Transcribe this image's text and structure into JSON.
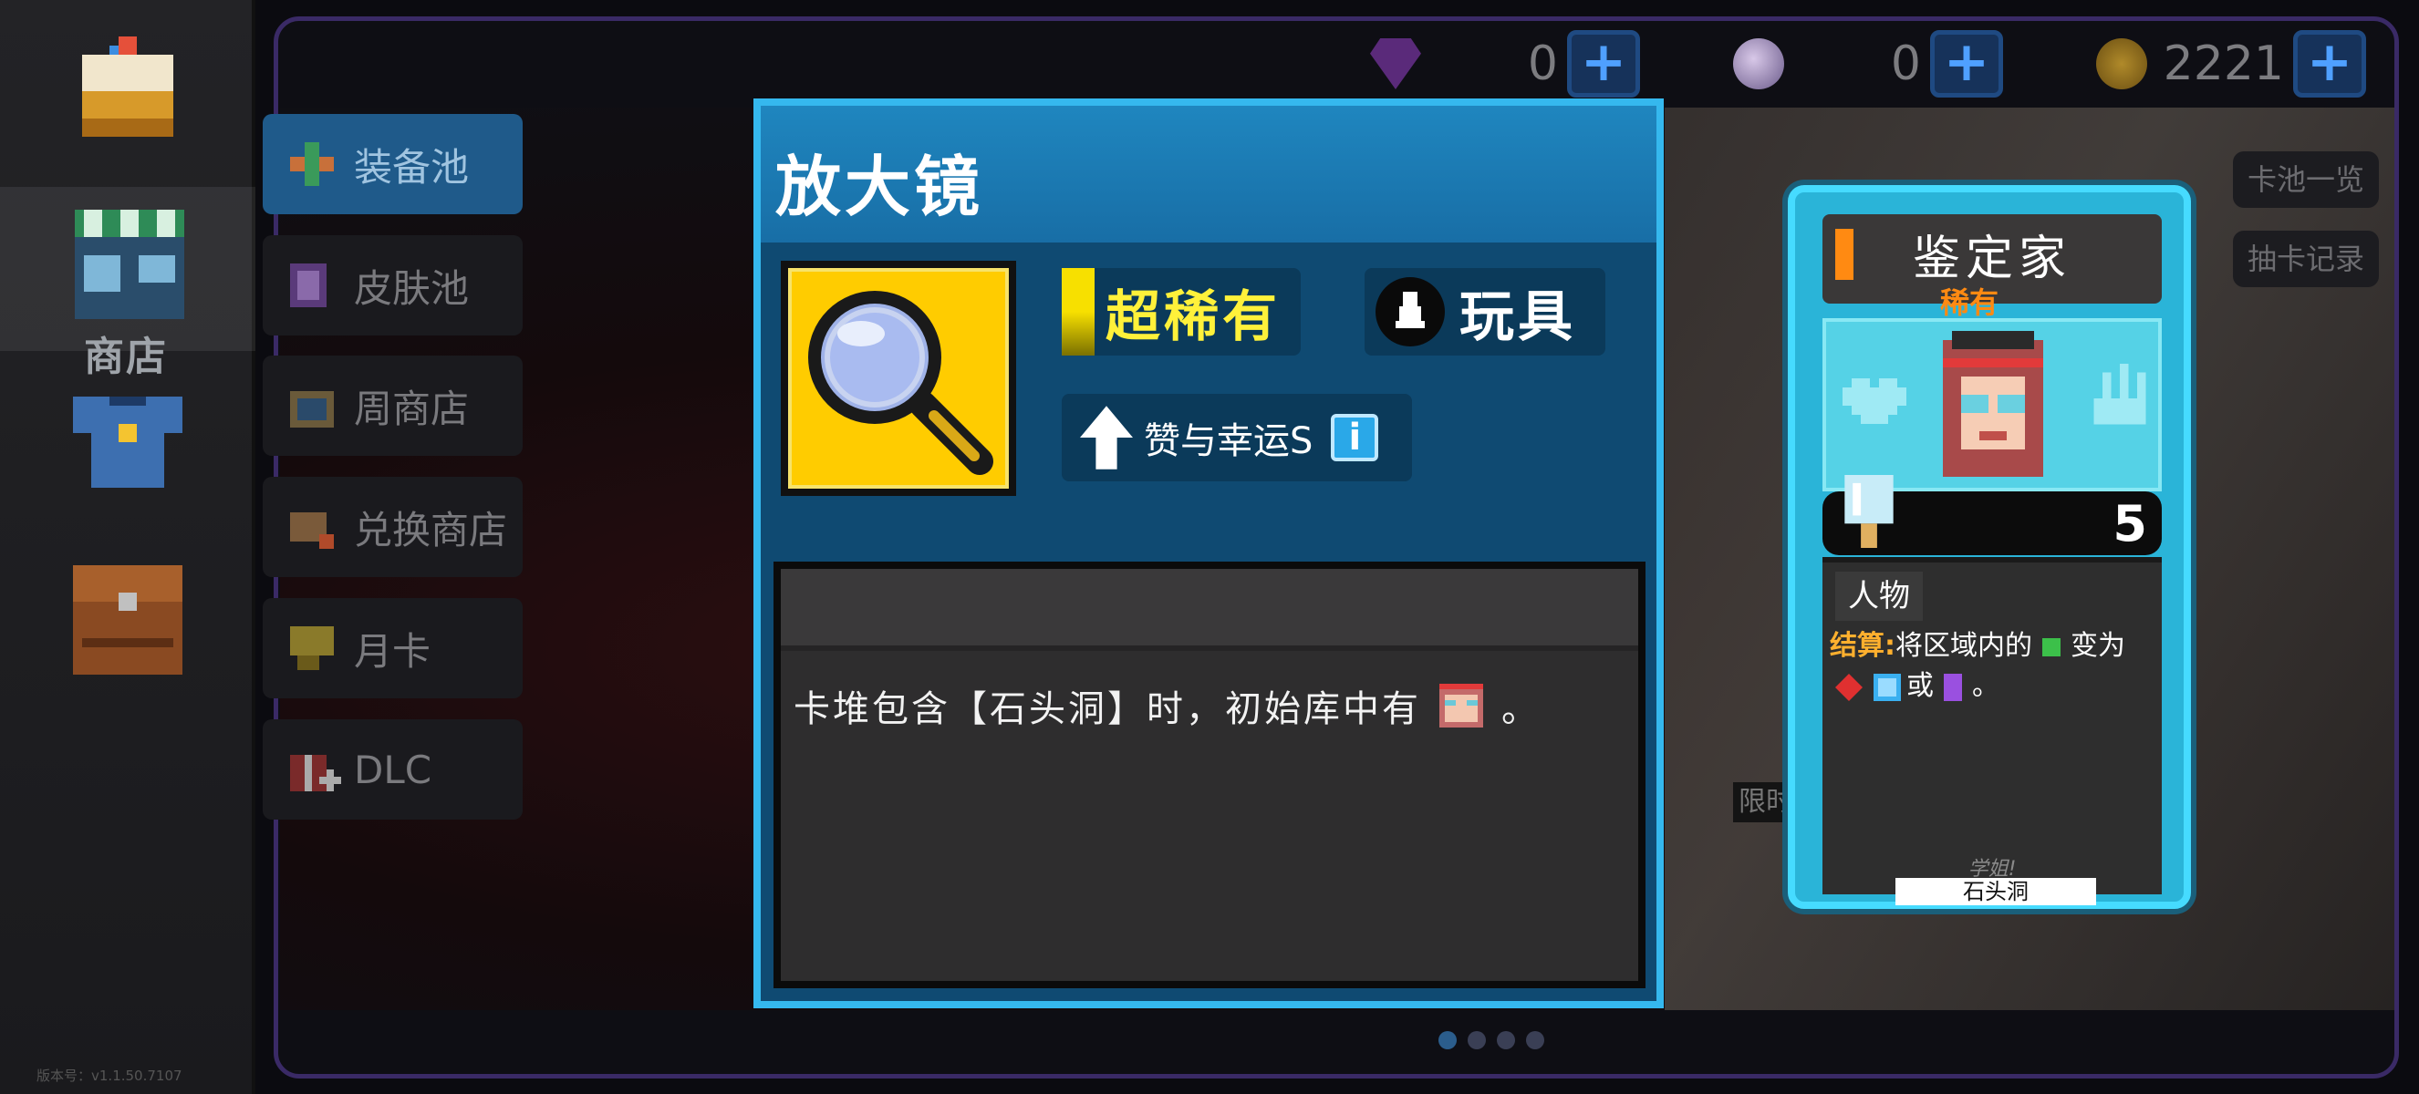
{
  "rail": {
    "shop_label": "商店",
    "version": "版本号：v1.1.50.7107"
  },
  "currencies": [
    {
      "name": "gem",
      "value": "0",
      "plus": "+"
    },
    {
      "name": "orb",
      "value": "0",
      "plus": "+"
    },
    {
      "name": "coin",
      "value": "2221",
      "plus": "+"
    }
  ],
  "tabs": [
    {
      "label": "装备池"
    },
    {
      "label": "皮肤池"
    },
    {
      "label": "周商店"
    },
    {
      "label": "兑换商店"
    },
    {
      "label": "月卡"
    },
    {
      "label": "DLC"
    }
  ],
  "side_buttons": {
    "pool_list": "卡池一览",
    "draw_history": "抽卡记录"
  },
  "dialog": {
    "title": "放大镜",
    "rarity": "超稀有",
    "type": "玩具",
    "tag": "赞与幸运S",
    "info": "i",
    "description_before": "卡堆包含【石头洞】时，初始库中有",
    "description_after": "。"
  },
  "card": {
    "name": "鉴定家",
    "rarity": "稀有",
    "count": "5",
    "type": "人物",
    "effect_key": "结算:",
    "effect_part1": "将区域内的",
    "effect_part2": "变为",
    "effect_part3": "或",
    "effect_part4": "。",
    "flavor": "学姐!",
    "area": "石头洞"
  },
  "limited_tag": "限时",
  "pager": {
    "pages": 4,
    "current": 1
  },
  "colors": {
    "dialog_border": "#35b8ee",
    "rarity_super": "#fff13a",
    "rarity_rare": "#ff8a12",
    "card_bg": "#2ab4d8"
  }
}
